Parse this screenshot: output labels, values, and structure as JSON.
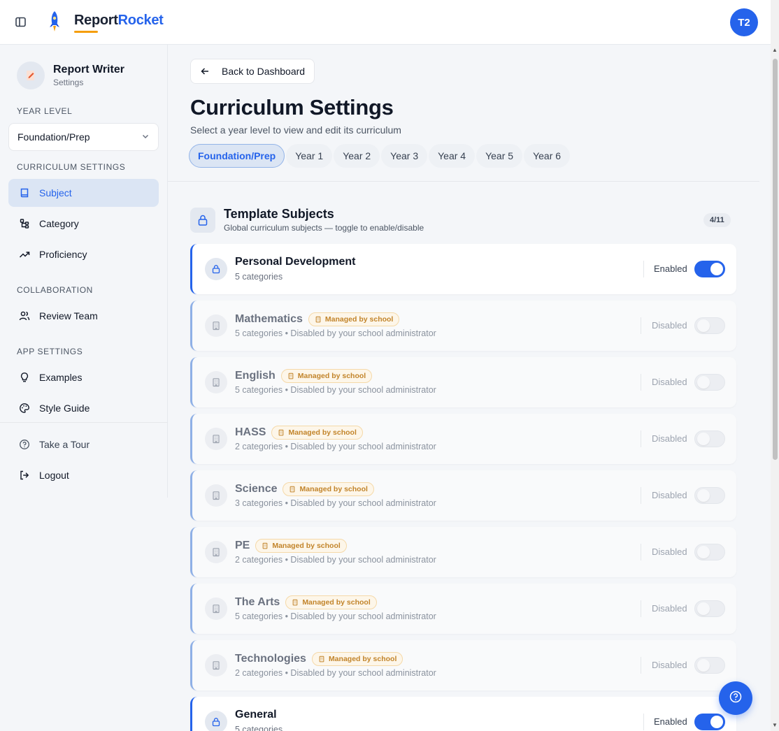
{
  "app": {
    "logo_part1": "Report",
    "logo_part2": "Rocket",
    "avatar": "T2"
  },
  "colors": {
    "accent": "#2563eb",
    "managed_badge": "#c2842a",
    "logo_underline": "#f59e0b"
  },
  "sidebar": {
    "title": "Report Writer",
    "subtitle": "Settings",
    "year_level_heading": "YEAR LEVEL",
    "year_level_value": "Foundation/Prep",
    "curriculum_heading": "CURRICULUM SETTINGS",
    "collaboration_heading": "COLLABORATION",
    "app_settings_heading": "APP SETTINGS",
    "items": [
      {
        "label": "Subject",
        "icon": "book-icon",
        "active": true
      },
      {
        "label": "Category",
        "icon": "category-tree-icon"
      },
      {
        "label": "Proficiency",
        "icon": "trending-up-icon"
      },
      {
        "label": "Review Team",
        "icon": "users-icon"
      },
      {
        "label": "Examples",
        "icon": "lightbulb-icon"
      },
      {
        "label": "Style Guide",
        "icon": "palette-icon"
      },
      {
        "label": "Take a Tour",
        "icon": "help-circle-icon"
      },
      {
        "label": "Logout",
        "icon": "logout-icon"
      }
    ]
  },
  "main": {
    "back_label": "Back to Dashboard",
    "title": "Curriculum Settings",
    "subtitle": "Select a year level to view and edit its curriculum",
    "tabs": [
      "Foundation/Prep",
      "Year 1",
      "Year 2",
      "Year 3",
      "Year 4",
      "Year 5",
      "Year 6"
    ],
    "active_tab": "Foundation/Prep",
    "section": {
      "title": "Template Subjects",
      "subtitle": "Global curriculum subjects — toggle to enable/disable",
      "count": "4/11"
    },
    "managed_label": "Managed by school",
    "subjects": [
      {
        "name": "Personal Development",
        "meta": "5 categories",
        "status": "Enabled",
        "enabled": true,
        "managed": false
      },
      {
        "name": "Mathematics",
        "meta": "5 categories • Disabled by your school administrator",
        "status": "Disabled",
        "enabled": false,
        "managed": true
      },
      {
        "name": "English",
        "meta": "5 categories • Disabled by your school administrator",
        "status": "Disabled",
        "enabled": false,
        "managed": true
      },
      {
        "name": "HASS",
        "meta": "2 categories • Disabled by your school administrator",
        "status": "Disabled",
        "enabled": false,
        "managed": true
      },
      {
        "name": "Science",
        "meta": "3 categories • Disabled by your school administrator",
        "status": "Disabled",
        "enabled": false,
        "managed": true
      },
      {
        "name": "PE",
        "meta": "2 categories • Disabled by your school administrator",
        "status": "Disabled",
        "enabled": false,
        "managed": true
      },
      {
        "name": "The Arts",
        "meta": "5 categories • Disabled by your school administrator",
        "status": "Disabled",
        "enabled": false,
        "managed": true
      },
      {
        "name": "Technologies",
        "meta": "2 categories • Disabled by your school administrator",
        "status": "Disabled",
        "enabled": false,
        "managed": true
      },
      {
        "name": "General",
        "meta": "5 categories",
        "status": "Enabled",
        "enabled": true,
        "managed": false
      }
    ]
  }
}
